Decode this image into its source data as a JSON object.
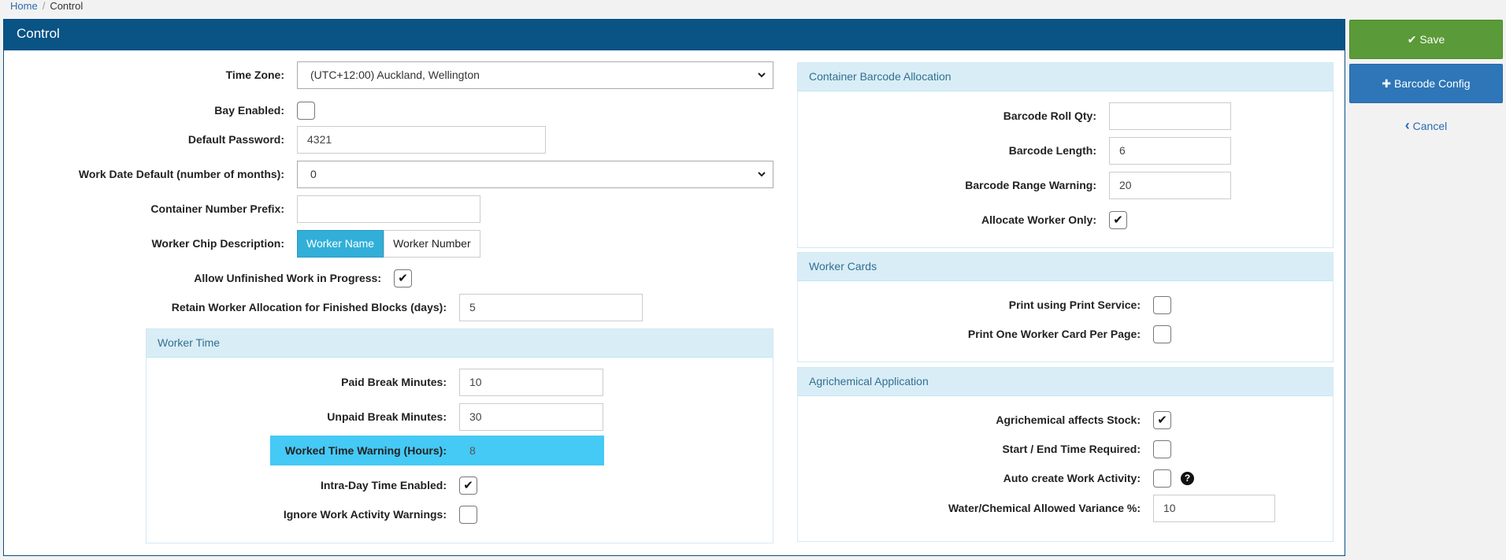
{
  "breadcrumb": {
    "home": "Home",
    "current": "Control"
  },
  "panel": {
    "title": "Control"
  },
  "left": {
    "time_zone": {
      "label": "Time Zone:",
      "value": "(UTC+12:00) Auckland, Wellington"
    },
    "bay_enabled": {
      "label": "Bay Enabled:",
      "checked": false
    },
    "default_password": {
      "label": "Default Password:",
      "value": "4321"
    },
    "work_date_default": {
      "label": "Work Date Default (number of months):",
      "value": "0"
    },
    "container_prefix": {
      "label": "Container Number Prefix:",
      "value": ""
    },
    "worker_chip": {
      "label": "Worker Chip Description:",
      "options": [
        "Worker Name",
        "Worker Number"
      ],
      "selected": "Worker Name"
    },
    "allow_unfinished": {
      "label": "Allow Unfinished Work in Progress:",
      "checked": true
    },
    "retain_allocation": {
      "label": "Retain Worker Allocation for Finished Blocks (days):",
      "value": "5"
    }
  },
  "worker_time": {
    "title": "Worker Time",
    "paid_break": {
      "label": "Paid Break Minutes:",
      "value": "10"
    },
    "unpaid_break": {
      "label": "Unpaid Break Minutes:",
      "value": "30"
    },
    "worked_warning": {
      "label": "Worked Time Warning (Hours):",
      "value": "8"
    },
    "intra_day": {
      "label": "Intra-Day Time Enabled:",
      "checked": true
    },
    "ignore_warnings": {
      "label": "Ignore Work Activity Warnings:",
      "checked": false
    }
  },
  "barcode_allocation": {
    "title": "Container Barcode Allocation",
    "roll_qty": {
      "label": "Barcode Roll Qty:",
      "value": ""
    },
    "length": {
      "label": "Barcode Length:",
      "value": "6"
    },
    "range_warning": {
      "label": "Barcode Range Warning:",
      "value": "20"
    },
    "allocate_worker_only": {
      "label": "Allocate Worker Only:",
      "checked": true
    }
  },
  "worker_cards": {
    "title": "Worker Cards",
    "print_service": {
      "label": "Print using Print Service:",
      "checked": false
    },
    "one_per_page": {
      "label": "Print One Worker Card Per Page:",
      "checked": false
    }
  },
  "agrichemical": {
    "title": "Agrichemical Application",
    "affects_stock": {
      "label": "Agrichemical affects Stock:",
      "checked": true
    },
    "start_end_required": {
      "label": "Start / End Time Required:",
      "checked": false
    },
    "auto_create": {
      "label": "Auto create Work Activity:",
      "checked": false
    },
    "variance": {
      "label": "Water/Chemical Allowed Variance %:",
      "value": "10"
    }
  },
  "actions": {
    "save_label": "Save",
    "barcode_config_label": "Barcode Config",
    "cancel_label": "Cancel"
  },
  "icons": {
    "check": "✔",
    "plus": "✚",
    "chevron_left": "‹",
    "chevron_down": "⌄",
    "help": "?"
  },
  "colors": {
    "header": "#0a5385",
    "save": "#5a9a38",
    "barcode": "#2e76b8",
    "segment_active": "#31afd8",
    "highlight": "#45c9f5"
  }
}
